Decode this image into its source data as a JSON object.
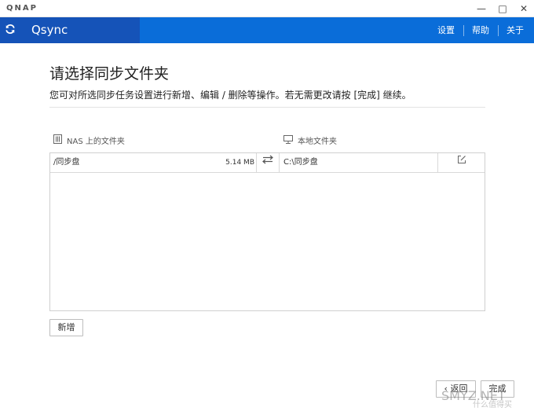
{
  "window": {
    "brand": "QNAP",
    "minimize": "—",
    "maximize": "□",
    "close": "✕"
  },
  "header": {
    "app_name": "Qsync",
    "menu": {
      "settings": "设置",
      "help": "帮助",
      "about": "关于"
    },
    "accent_color": "#0a6dd9",
    "accent_dark": "#1553b8"
  },
  "main": {
    "title": "请选择同步文件夹",
    "description": "您可对所选同步任务设置进行新增、编辑 / 删除等操作。若无需更改请按 [完成] 继续。",
    "columns": {
      "nas": "NAS 上的文件夹",
      "local": "本地文件夹"
    },
    "rows": [
      {
        "nas_folder": "/同步盘",
        "size": "5.14 MB",
        "local_folder": "C:\\同步盘"
      }
    ],
    "add_button": "新增"
  },
  "footer": {
    "back_button": "‹ 返回",
    "done_button": "完成"
  },
  "watermark": {
    "text": "SMYZ.NET",
    "sub": "什么值得买"
  },
  "icons": [
    "sync-icon",
    "nas-icon",
    "computer-icon",
    "sync-arrows-icon",
    "edit-icon"
  ]
}
